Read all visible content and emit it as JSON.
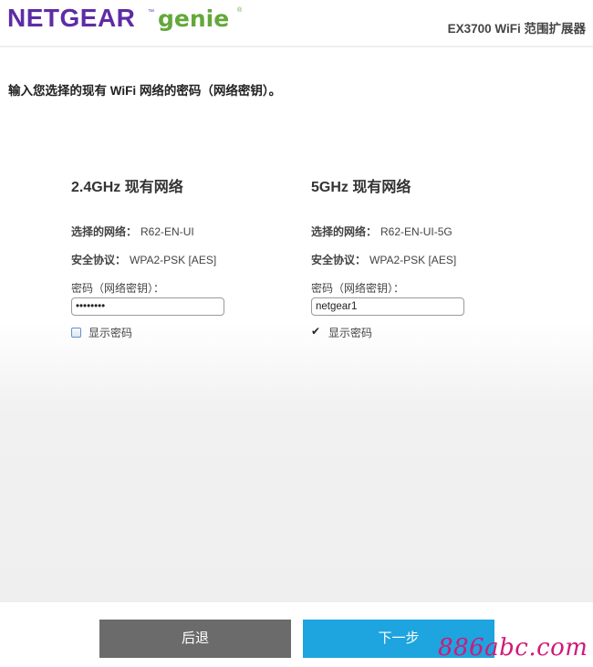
{
  "header": {
    "logo_netgear": "NETGEAR",
    "logo_genie": "genie",
    "logo_tm": "™",
    "logo_reg": "®",
    "product_title": "EX3700 WiFi 范围扩展器"
  },
  "instruction": "输入您选择的现有 WiFi 网络的密码（网络密钥）。",
  "networks": [
    {
      "heading": "2.4GHz 现有网络",
      "ssid_label": "选择的网络：",
      "ssid_value": "R62-EN-UI",
      "security_label": "安全协议：",
      "security_value": "WPA2-PSK [AES]",
      "password_label": "密码（网络密钥）：",
      "password_value": "••••••••",
      "show_password_label": "显示密码",
      "show_password_checked": false
    },
    {
      "heading": "5GHz 现有网络",
      "ssid_label": "选择的网络：",
      "ssid_value": "R62-EN-UI-5G",
      "security_label": "安全协议：",
      "security_value": "WPA2-PSK [AES]",
      "password_label": "密码（网络密钥）：",
      "password_value": "netgear1",
      "show_password_label": "显示密码",
      "show_password_checked": true
    }
  ],
  "footer": {
    "back_label": "后退",
    "next_label": "下一步",
    "watermark": "886abc.com"
  },
  "colors": {
    "brand_purple": "#5e2ca5",
    "brand_green": "#63a83a",
    "back_button": "#6b6b6b",
    "next_button": "#1ea4de",
    "watermark": "#d2187a"
  }
}
